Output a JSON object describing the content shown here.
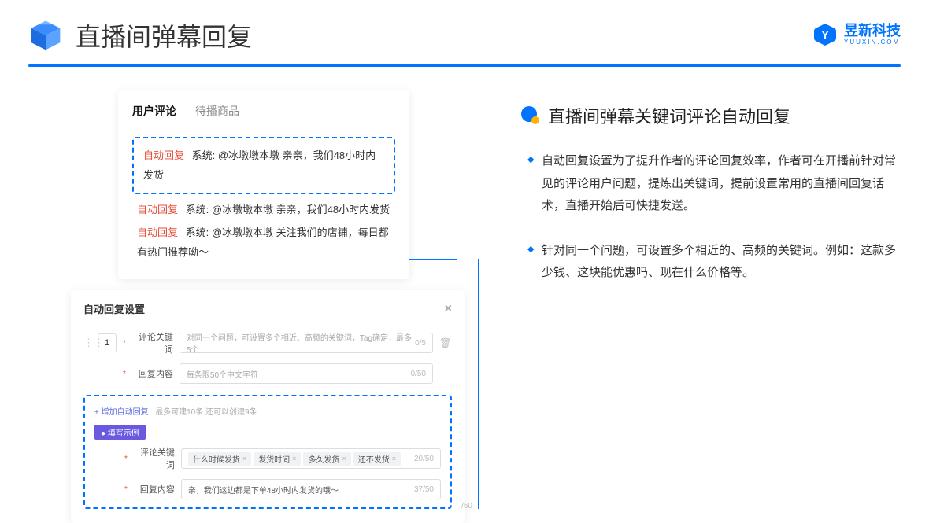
{
  "page_title": "直播间弹幕回复",
  "brand": {
    "cn": "昱新科技",
    "en": "YUUXIN.COM"
  },
  "left": {
    "tabs": [
      "用户评论",
      "待播商品"
    ],
    "messages": [
      {
        "tag": "自动回复",
        "rest": " 系统: @冰墩墩本墩 亲亲，我们48小时内发货"
      },
      {
        "tag": "自动回复",
        "rest": " 系统: @冰墩墩本墩 亲亲，我们48小时内发货"
      },
      {
        "tag": "自动回复",
        "rest": " 系统: @冰墩墩本墩 关注我们的店铺，每日都有热门推荐呦～"
      }
    ],
    "settings": {
      "title": "自动回复设置",
      "order": "1",
      "kw_label": "评论关键词",
      "kw_placeholder": "对同一个问题，可设置多个相近、高频的关键词，Tag确定，最多5个",
      "kw_count": "0/5",
      "reply_label": "回复内容",
      "reply_placeholder": "每条限50个中文字符",
      "reply_count": "0/50",
      "add_text": "+ 增加自动回复",
      "add_hint": "最多可建10条 还可以创建9条",
      "example_badge": "● 填写示例",
      "ex_kw_label": "评论关键词",
      "ex_tags": [
        "什么时候发货",
        "发货时间",
        "多久发货",
        "还不发货"
      ],
      "ex_kw_count": "20/50",
      "ex_reply_label": "回复内容",
      "ex_reply_value": "亲，我们这边都是下单48小时内发货的哦～",
      "ex_reply_count": "37/50",
      "outside_count": "/50"
    }
  },
  "right": {
    "subtitle": "直播间弹幕关键词评论自动回复",
    "bullets": [
      "自动回复设置为了提升作者的评论回复效率，作者可在开播前针对常见的评论用户问题，提炼出关键词，提前设置常用的直播间回复话术，直播开始后可快捷发送。",
      "针对同一个问题，可设置多个相近的、高频的关键词。例如：这款多少钱、这块能优惠吗、现在什么价格等。"
    ]
  }
}
